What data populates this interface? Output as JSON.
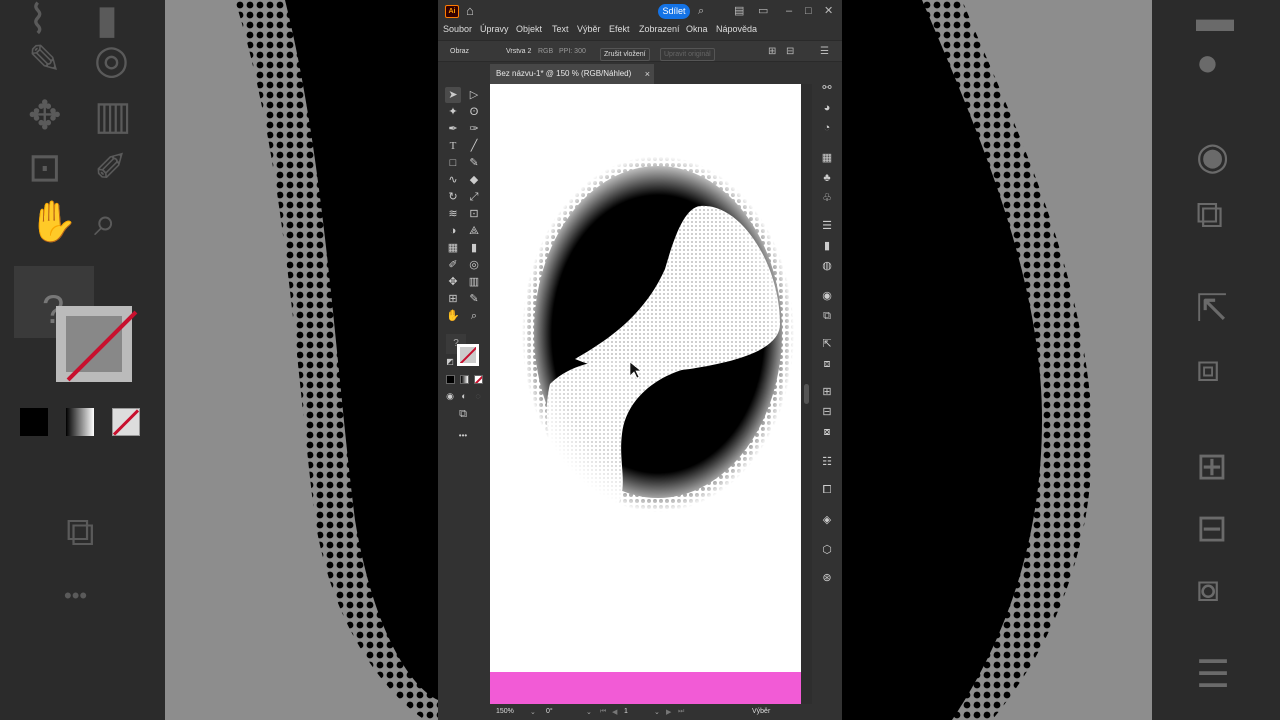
{
  "app": {
    "logo_text": "Ai",
    "share_label": "Sdílet",
    "icons": [
      "home-icon",
      "search-icon",
      "arrange-documents-icon",
      "panel-layout-icon",
      "minimize-icon",
      "maximize-icon",
      "close-icon"
    ]
  },
  "menubar": {
    "items": [
      "Soubor",
      "Úpravy",
      "Objekt",
      "Text",
      "Výběr",
      "Efekt",
      "Zobrazení",
      "Okna",
      "Nápověda"
    ]
  },
  "control_bar": {
    "object_label": "Obraz",
    "layer_label": "Vrstva 2",
    "color_mode": "RGB",
    "ppi": "PPI: 300",
    "unembed_button": "Zrušit vložení",
    "edit_original_button": "Upravit originál"
  },
  "document_tab": {
    "title": "Bez názvu-1* @ 150 % (RGB/Náhled)",
    "close_glyph": "×"
  },
  "toolbar": {
    "unknown_glyph": "?",
    "more_glyph": "•••"
  },
  "statusbar": {
    "zoom": "150%",
    "rotation": "0°",
    "artboard": "1",
    "mode": "Výběr"
  },
  "colors": {
    "accent": "#1473e6",
    "artboard_strip": "#f25bd6",
    "ui_bg": "#323232"
  }
}
